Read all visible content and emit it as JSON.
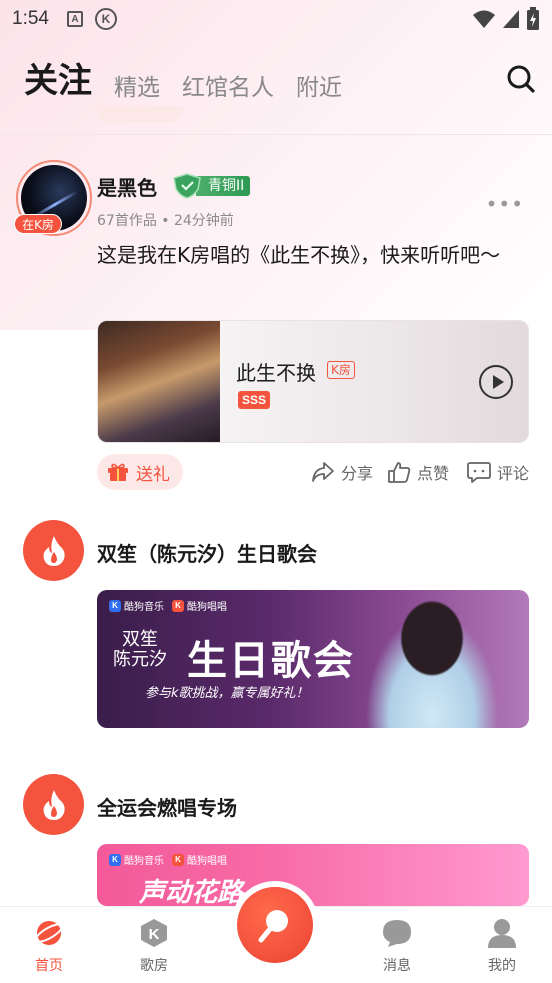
{
  "status_bar": {
    "time": "1:54",
    "icons": [
      "a-notification-icon",
      "k-app-icon",
      "wifi-icon",
      "signal-icon",
      "battery-icon"
    ]
  },
  "top_nav": {
    "tabs": [
      {
        "label": "关注",
        "active": true
      },
      {
        "label": "精选",
        "active": false
      },
      {
        "label": "红馆名人",
        "active": false
      },
      {
        "label": "附近",
        "active": false
      }
    ],
    "search_icon": "search-icon"
  },
  "post": {
    "avatar_badge": "在K房",
    "username": "是黑色",
    "level": "青铜II",
    "meta": "67首作品 • 24分钟前",
    "text": "这是我在K房唱的《此生不换》，快来听听吧～",
    "song": {
      "title": "此生不换",
      "tag": "K房",
      "score": "SSS"
    },
    "actions": {
      "gift": "送礼",
      "share": "分享",
      "like": "点赞",
      "comment": "评论"
    }
  },
  "sections": [
    {
      "title": "双笙（陈元汐）生日歌会",
      "banner": {
        "logos": [
          "酷狗音乐",
          "酷狗唱唱"
        ],
        "sub": "双笙\n陈元汐",
        "big": "生日歌会",
        "slogan": "参与k歌挑战，赢专属好礼！"
      }
    },
    {
      "title": "全运会燃唱专场",
      "banner": {
        "logos": [
          "酷狗音乐",
          "酷狗唱唱"
        ],
        "big": "声动花路"
      }
    }
  ],
  "bottom_nav": {
    "items": [
      {
        "label": "首页",
        "icon": "planet-icon",
        "active": true
      },
      {
        "label": "歌房",
        "icon": "k-room-icon",
        "active": false
      },
      {
        "label": "",
        "icon": "microphone-icon",
        "active": false
      },
      {
        "label": "消息",
        "icon": "chat-bubble-icon",
        "active": false
      },
      {
        "label": "我的",
        "icon": "profile-icon",
        "active": false
      }
    ]
  },
  "colors": {
    "accent": "#f4533e",
    "level_badge": "#3aa45e",
    "text_primary": "#1a1a1a",
    "text_secondary": "#8a8a8a"
  }
}
